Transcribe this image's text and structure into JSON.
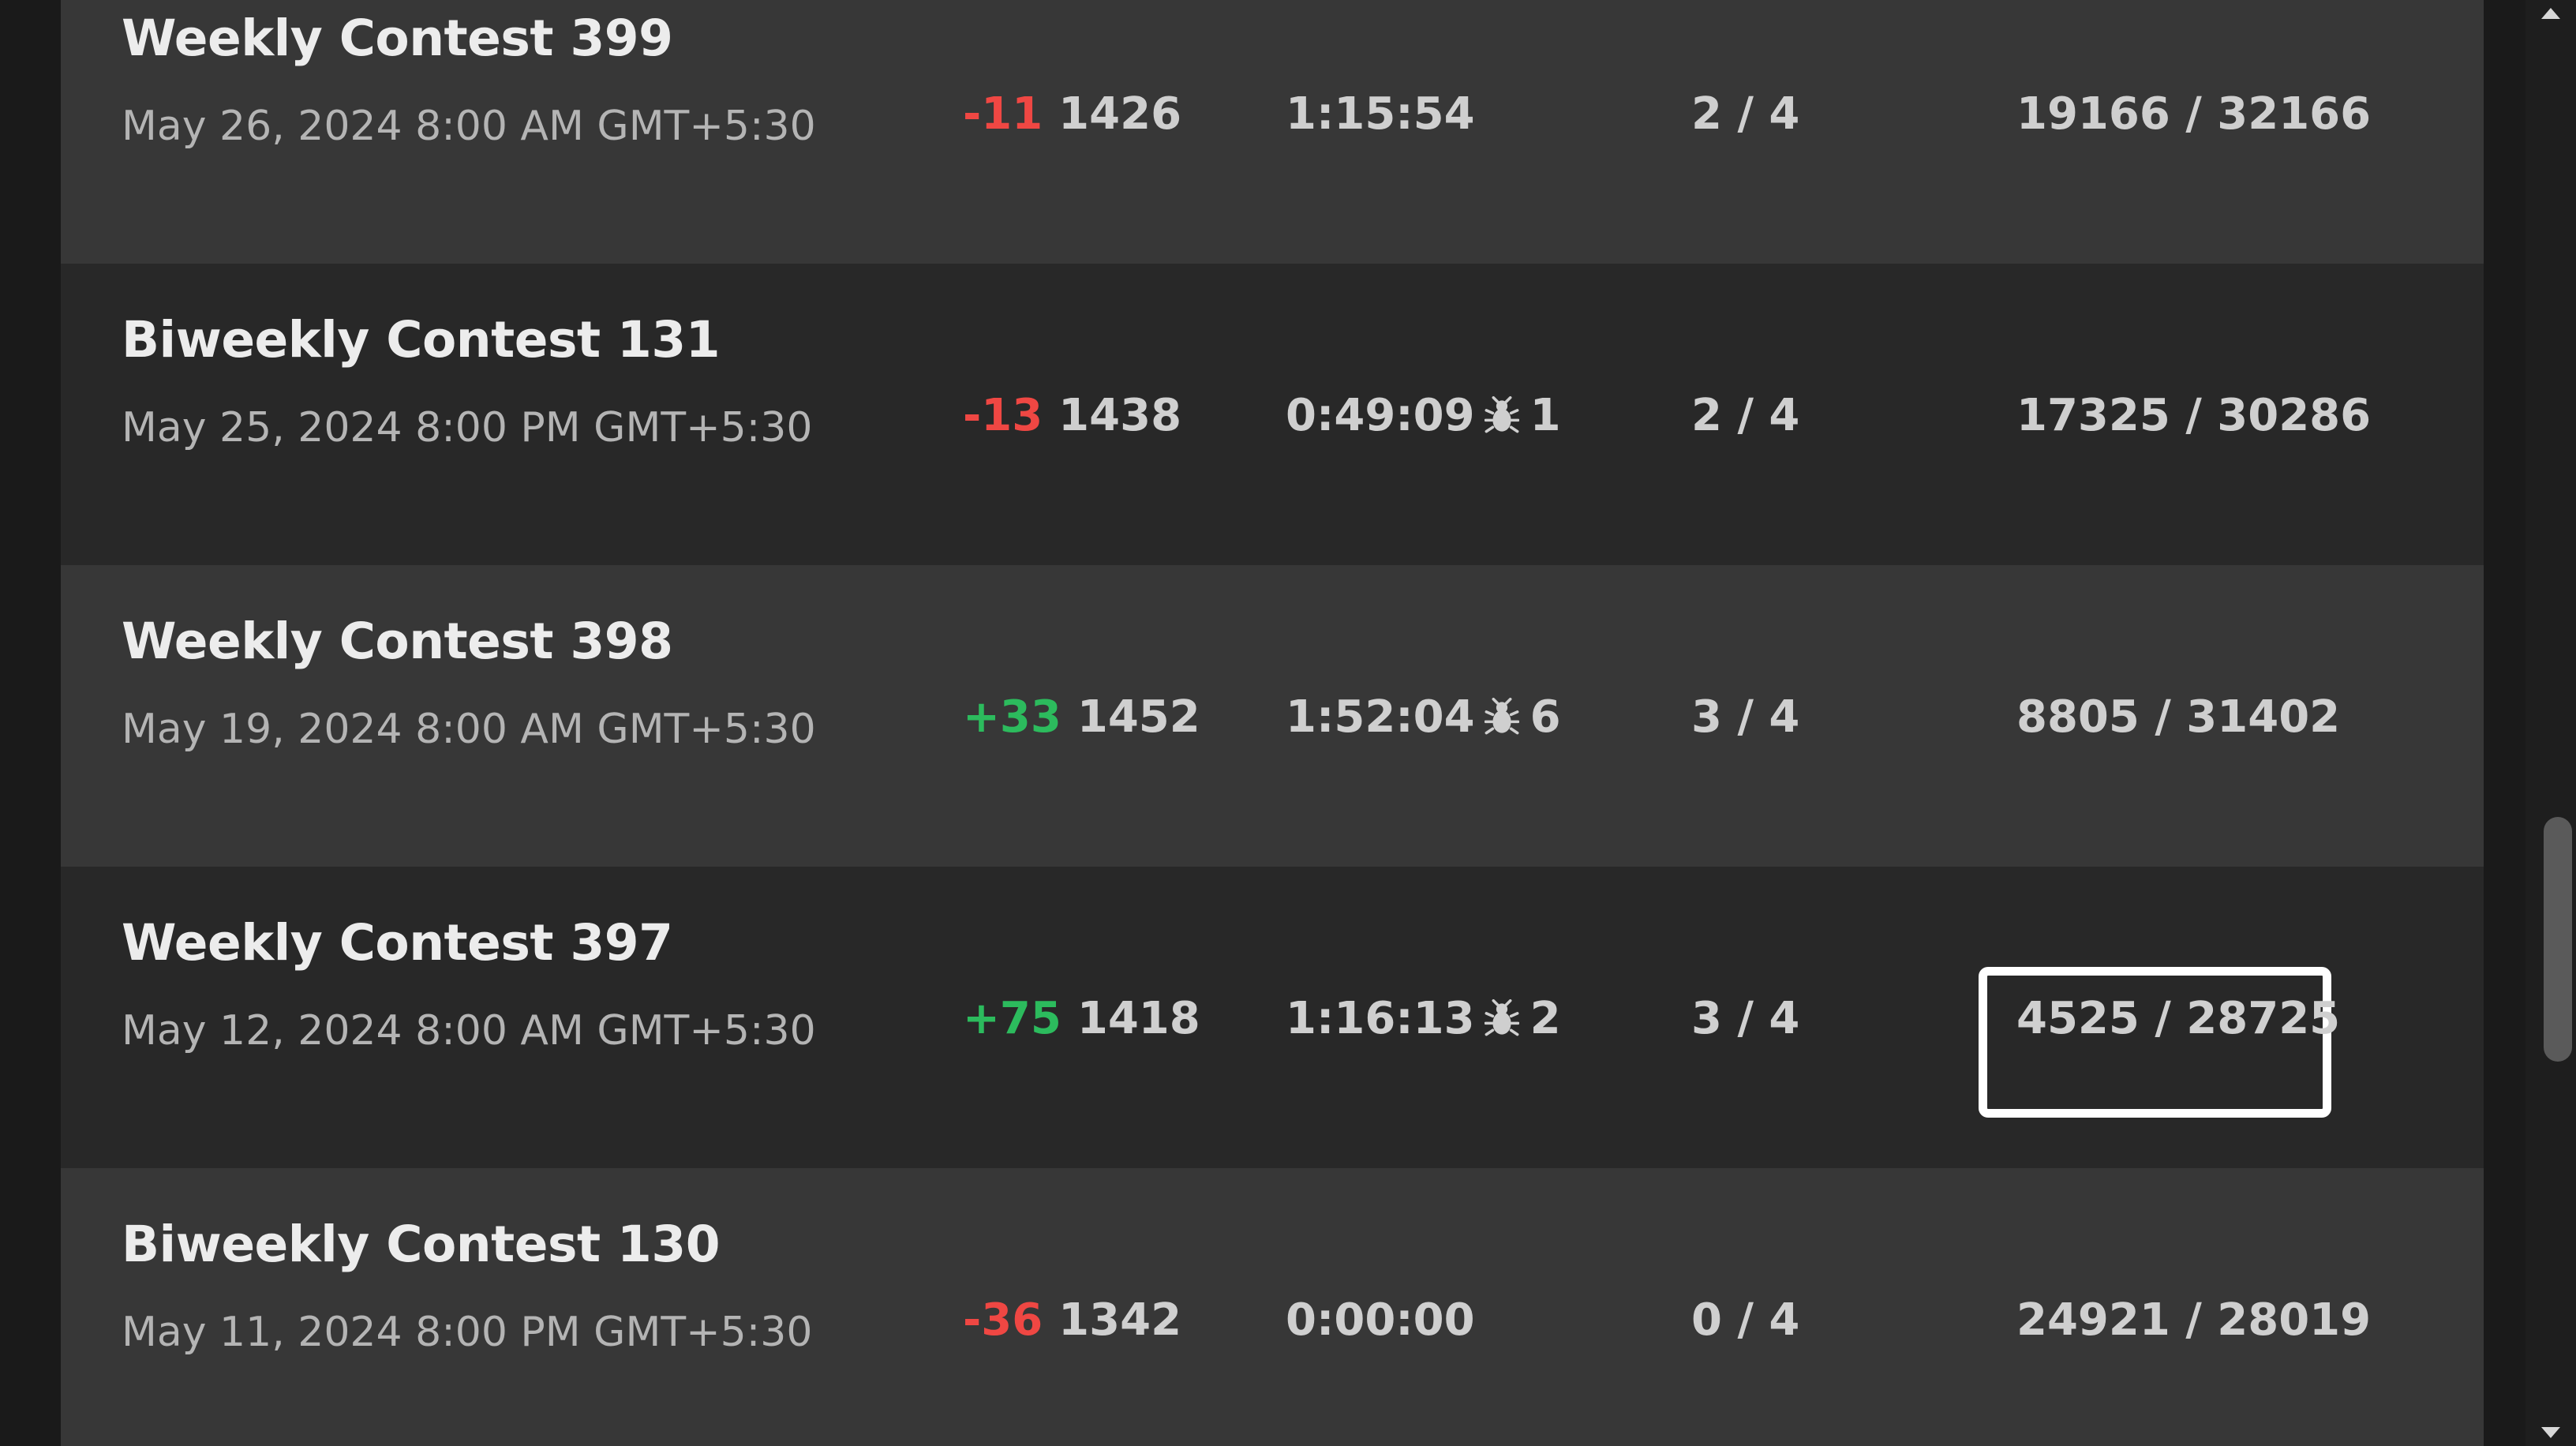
{
  "rows": [
    {
      "name": "Weekly Contest 399",
      "date": "May 26, 2024 8:00 AM GMT+5:30",
      "delta": "-11",
      "rating": "1426",
      "finish_time": "1:15:54",
      "wrong_submissions": "",
      "solved": "2 / 4",
      "ranking": "19166 / 32166"
    },
    {
      "name": "Biweekly Contest 131",
      "date": "May 25, 2024 8:00 PM GMT+5:30",
      "delta": "-13",
      "rating": "1438",
      "finish_time": "0:49:09",
      "wrong_submissions": "1",
      "solved": "2 / 4",
      "ranking": "17325 / 30286"
    },
    {
      "name": "Weekly Contest 398",
      "date": "May 19, 2024 8:00 AM GMT+5:30",
      "delta": "+33",
      "rating": "1452",
      "finish_time": "1:52:04",
      "wrong_submissions": "6",
      "solved": "3 / 4",
      "ranking": "8805 / 31402"
    },
    {
      "name": "Weekly Contest 397",
      "date": "May 12, 2024 8:00 AM GMT+5:30",
      "delta": "+75",
      "rating": "1418",
      "finish_time": "1:16:13",
      "wrong_submissions": "2",
      "solved": "3 / 4",
      "ranking": "4525 / 28725"
    },
    {
      "name": "Biweekly Contest 130",
      "date": "May 11, 2024 8:00 PM GMT+5:30",
      "delta": "-36",
      "rating": "1342",
      "finish_time": "0:00:00",
      "wrong_submissions": "",
      "solved": "0 / 4",
      "ranking": "24921 / 28019"
    }
  ],
  "colors": {
    "negative": "#ef4743",
    "positive": "#2cbb5d",
    "row_light": "#373737",
    "row_dark": "#282828"
  },
  "icons": {
    "wrong_submission": "bug-icon"
  }
}
